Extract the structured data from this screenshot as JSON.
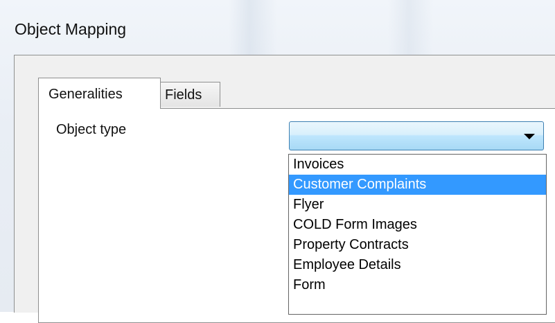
{
  "window": {
    "title": "Object Mapping"
  },
  "tabs": [
    {
      "label": "Generalities",
      "active": true
    },
    {
      "label": "Fields",
      "active": false
    }
  ],
  "form": {
    "object_type_label": "Object type",
    "object_type_value": ""
  },
  "dropdown": {
    "options": [
      "Invoices",
      "Customer Complaints",
      "Flyer",
      "COLD Form Images",
      "Property Contracts",
      "Employee Details",
      "Form"
    ],
    "highlighted_option": "Customer Complaints"
  },
  "colors": {
    "highlight": "#3399ff",
    "combo_border": "#3c7fb1"
  },
  "icons": {
    "combo_arrow": "chevron-down-icon"
  }
}
